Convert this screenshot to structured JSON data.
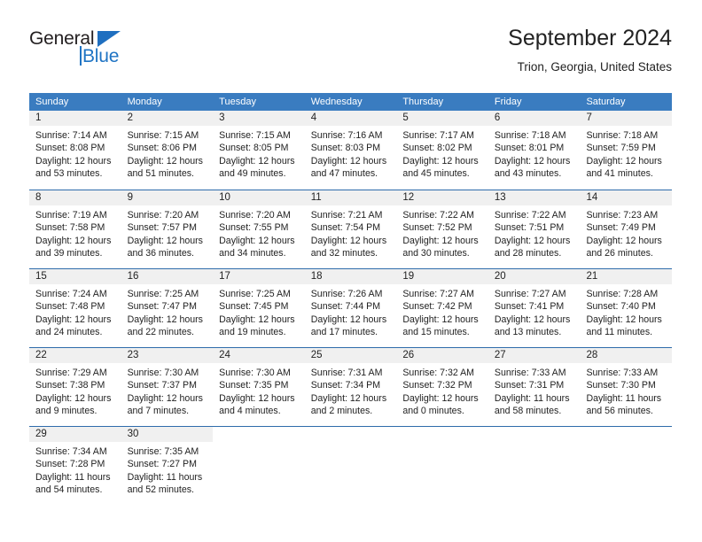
{
  "brand": {
    "name_part1": "General",
    "name_part2": "Blue",
    "triangle_icon": "triangle-icon",
    "color_dark": "#231f20",
    "color_blue": "#1f74c4"
  },
  "header": {
    "title": "September 2024",
    "location": "Trion, Georgia, United States"
  },
  "theme": {
    "header_blue": "#3a7cc0",
    "row_divider_blue": "#2f6cab",
    "day_band_gray": "#f0f0f0",
    "text": "#222222"
  },
  "calendar": {
    "day_headers": [
      "Sunday",
      "Monday",
      "Tuesday",
      "Wednesday",
      "Thursday",
      "Friday",
      "Saturday"
    ],
    "weeks": [
      [
        {
          "day": "1",
          "lines": [
            "Sunrise: 7:14 AM",
            "Sunset: 8:08 PM",
            "Daylight: 12 hours",
            "and 53 minutes."
          ]
        },
        {
          "day": "2",
          "lines": [
            "Sunrise: 7:15 AM",
            "Sunset: 8:06 PM",
            "Daylight: 12 hours",
            "and 51 minutes."
          ]
        },
        {
          "day": "3",
          "lines": [
            "Sunrise: 7:15 AM",
            "Sunset: 8:05 PM",
            "Daylight: 12 hours",
            "and 49 minutes."
          ]
        },
        {
          "day": "4",
          "lines": [
            "Sunrise: 7:16 AM",
            "Sunset: 8:03 PM",
            "Daylight: 12 hours",
            "and 47 minutes."
          ]
        },
        {
          "day": "5",
          "lines": [
            "Sunrise: 7:17 AM",
            "Sunset: 8:02 PM",
            "Daylight: 12 hours",
            "and 45 minutes."
          ]
        },
        {
          "day": "6",
          "lines": [
            "Sunrise: 7:18 AM",
            "Sunset: 8:01 PM",
            "Daylight: 12 hours",
            "and 43 minutes."
          ]
        },
        {
          "day": "7",
          "lines": [
            "Sunrise: 7:18 AM",
            "Sunset: 7:59 PM",
            "Daylight: 12 hours",
            "and 41 minutes."
          ]
        }
      ],
      [
        {
          "day": "8",
          "lines": [
            "Sunrise: 7:19 AM",
            "Sunset: 7:58 PM",
            "Daylight: 12 hours",
            "and 39 minutes."
          ]
        },
        {
          "day": "9",
          "lines": [
            "Sunrise: 7:20 AM",
            "Sunset: 7:57 PM",
            "Daylight: 12 hours",
            "and 36 minutes."
          ]
        },
        {
          "day": "10",
          "lines": [
            "Sunrise: 7:20 AM",
            "Sunset: 7:55 PM",
            "Daylight: 12 hours",
            "and 34 minutes."
          ]
        },
        {
          "day": "11",
          "lines": [
            "Sunrise: 7:21 AM",
            "Sunset: 7:54 PM",
            "Daylight: 12 hours",
            "and 32 minutes."
          ]
        },
        {
          "day": "12",
          "lines": [
            "Sunrise: 7:22 AM",
            "Sunset: 7:52 PM",
            "Daylight: 12 hours",
            "and 30 minutes."
          ]
        },
        {
          "day": "13",
          "lines": [
            "Sunrise: 7:22 AM",
            "Sunset: 7:51 PM",
            "Daylight: 12 hours",
            "and 28 minutes."
          ]
        },
        {
          "day": "14",
          "lines": [
            "Sunrise: 7:23 AM",
            "Sunset: 7:49 PM",
            "Daylight: 12 hours",
            "and 26 minutes."
          ]
        }
      ],
      [
        {
          "day": "15",
          "lines": [
            "Sunrise: 7:24 AM",
            "Sunset: 7:48 PM",
            "Daylight: 12 hours",
            "and 24 minutes."
          ]
        },
        {
          "day": "16",
          "lines": [
            "Sunrise: 7:25 AM",
            "Sunset: 7:47 PM",
            "Daylight: 12 hours",
            "and 22 minutes."
          ]
        },
        {
          "day": "17",
          "lines": [
            "Sunrise: 7:25 AM",
            "Sunset: 7:45 PM",
            "Daylight: 12 hours",
            "and 19 minutes."
          ]
        },
        {
          "day": "18",
          "lines": [
            "Sunrise: 7:26 AM",
            "Sunset: 7:44 PM",
            "Daylight: 12 hours",
            "and 17 minutes."
          ]
        },
        {
          "day": "19",
          "lines": [
            "Sunrise: 7:27 AM",
            "Sunset: 7:42 PM",
            "Daylight: 12 hours",
            "and 15 minutes."
          ]
        },
        {
          "day": "20",
          "lines": [
            "Sunrise: 7:27 AM",
            "Sunset: 7:41 PM",
            "Daylight: 12 hours",
            "and 13 minutes."
          ]
        },
        {
          "day": "21",
          "lines": [
            "Sunrise: 7:28 AM",
            "Sunset: 7:40 PM",
            "Daylight: 12 hours",
            "and 11 minutes."
          ]
        }
      ],
      [
        {
          "day": "22",
          "lines": [
            "Sunrise: 7:29 AM",
            "Sunset: 7:38 PM",
            "Daylight: 12 hours",
            "and 9 minutes."
          ]
        },
        {
          "day": "23",
          "lines": [
            "Sunrise: 7:30 AM",
            "Sunset: 7:37 PM",
            "Daylight: 12 hours",
            "and 7 minutes."
          ]
        },
        {
          "day": "24",
          "lines": [
            "Sunrise: 7:30 AM",
            "Sunset: 7:35 PM",
            "Daylight: 12 hours",
            "and 4 minutes."
          ]
        },
        {
          "day": "25",
          "lines": [
            "Sunrise: 7:31 AM",
            "Sunset: 7:34 PM",
            "Daylight: 12 hours",
            "and 2 minutes."
          ]
        },
        {
          "day": "26",
          "lines": [
            "Sunrise: 7:32 AM",
            "Sunset: 7:32 PM",
            "Daylight: 12 hours",
            "and 0 minutes."
          ]
        },
        {
          "day": "27",
          "lines": [
            "Sunrise: 7:33 AM",
            "Sunset: 7:31 PM",
            "Daylight: 11 hours",
            "and 58 minutes."
          ]
        },
        {
          "day": "28",
          "lines": [
            "Sunrise: 7:33 AM",
            "Sunset: 7:30 PM",
            "Daylight: 11 hours",
            "and 56 minutes."
          ]
        }
      ],
      [
        {
          "day": "29",
          "lines": [
            "Sunrise: 7:34 AM",
            "Sunset: 7:28 PM",
            "Daylight: 11 hours",
            "and 54 minutes."
          ]
        },
        {
          "day": "30",
          "lines": [
            "Sunrise: 7:35 AM",
            "Sunset: 7:27 PM",
            "Daylight: 11 hours",
            "and 52 minutes."
          ]
        },
        {
          "day": "",
          "lines": []
        },
        {
          "day": "",
          "lines": []
        },
        {
          "day": "",
          "lines": []
        },
        {
          "day": "",
          "lines": []
        },
        {
          "day": "",
          "lines": []
        }
      ]
    ]
  }
}
